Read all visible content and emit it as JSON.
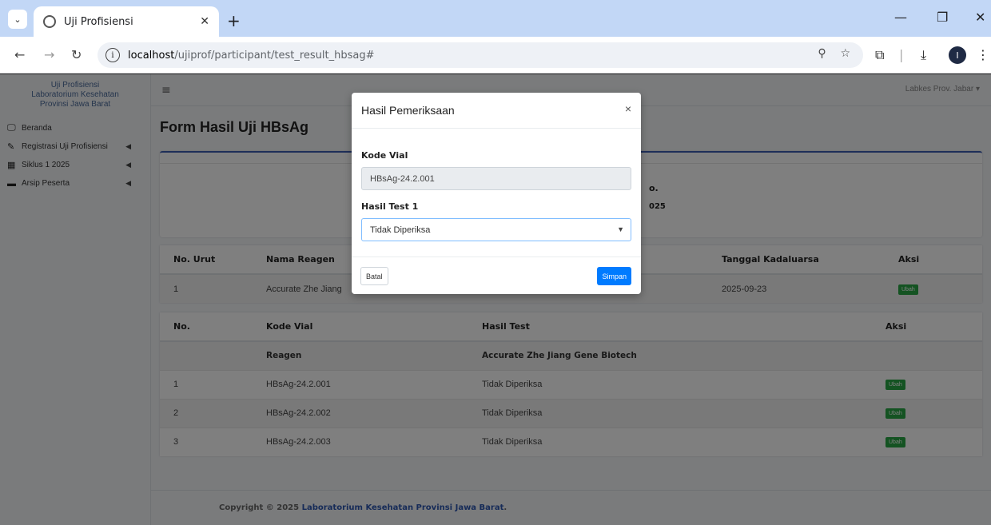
{
  "browser": {
    "tab_title": "Uji Profisiensi",
    "url_host": "localhost",
    "url_path": "/ujiprof/participant/test_result_hbsag#",
    "profile_initial": "I"
  },
  "sidebar": {
    "brand_line1": "Uji Profisiensi",
    "brand_line2": "Laboratorium Kesehatan",
    "brand_line3": "Provinsi Jawa Barat",
    "items": [
      {
        "label": "Beranda"
      },
      {
        "label": "Registrasi Uji Profisiensi"
      },
      {
        "label": "Siklus 1 2025"
      },
      {
        "label": "Arsip Peserta"
      }
    ]
  },
  "topnav": {
    "user": "Labkes Prov. Jabar ▾"
  },
  "page": {
    "title": "Form Hasil Uji HBsAg",
    "info_fragment_1": "o.",
    "info_fragment_2": "025"
  },
  "reagent_table": {
    "headers": [
      "No. Urut",
      "Nama Reagen",
      "Tanggal Kadaluarsa",
      "Aksi"
    ],
    "rows": [
      {
        "no": "1",
        "name": "Accurate Zhe Jiang",
        "expiry": "2025-09-23",
        "action": "Ubah"
      }
    ]
  },
  "result_table": {
    "headers": [
      "No.",
      "Kode Vial",
      "Hasil Test",
      "Aksi"
    ],
    "sub_label": "Reagen",
    "sub_value": "Accurate Zhe Jiang Gene Biotech",
    "rows": [
      {
        "no": "1",
        "kode": "HBsAg-24.2.001",
        "hasil": "Tidak Diperiksa",
        "action": "Ubah"
      },
      {
        "no": "2",
        "kode": "HBsAg-24.2.002",
        "hasil": "Tidak Diperiksa",
        "action": "Ubah"
      },
      {
        "no": "3",
        "kode": "HBsAg-24.2.003",
        "hasil": "Tidak Diperiksa",
        "action": "Ubah"
      }
    ]
  },
  "footer": {
    "prefix": "Copyright © 2025 ",
    "link": "Laboratorium Kesehatan Provinsi Jawa Barat",
    "suffix": "."
  },
  "modal": {
    "title": "Hasil Pemeriksaan",
    "close": "×",
    "kode_label": "Kode Vial",
    "kode_value": "HBsAg-24.2.001",
    "hasil_label": "Hasil Test 1",
    "hasil_value": "Tidak Diperiksa",
    "cancel": "Batal",
    "save": "Simpan"
  },
  "colors": {
    "primary": "#007bff",
    "success": "#28a745",
    "link": "#2d57b0"
  }
}
